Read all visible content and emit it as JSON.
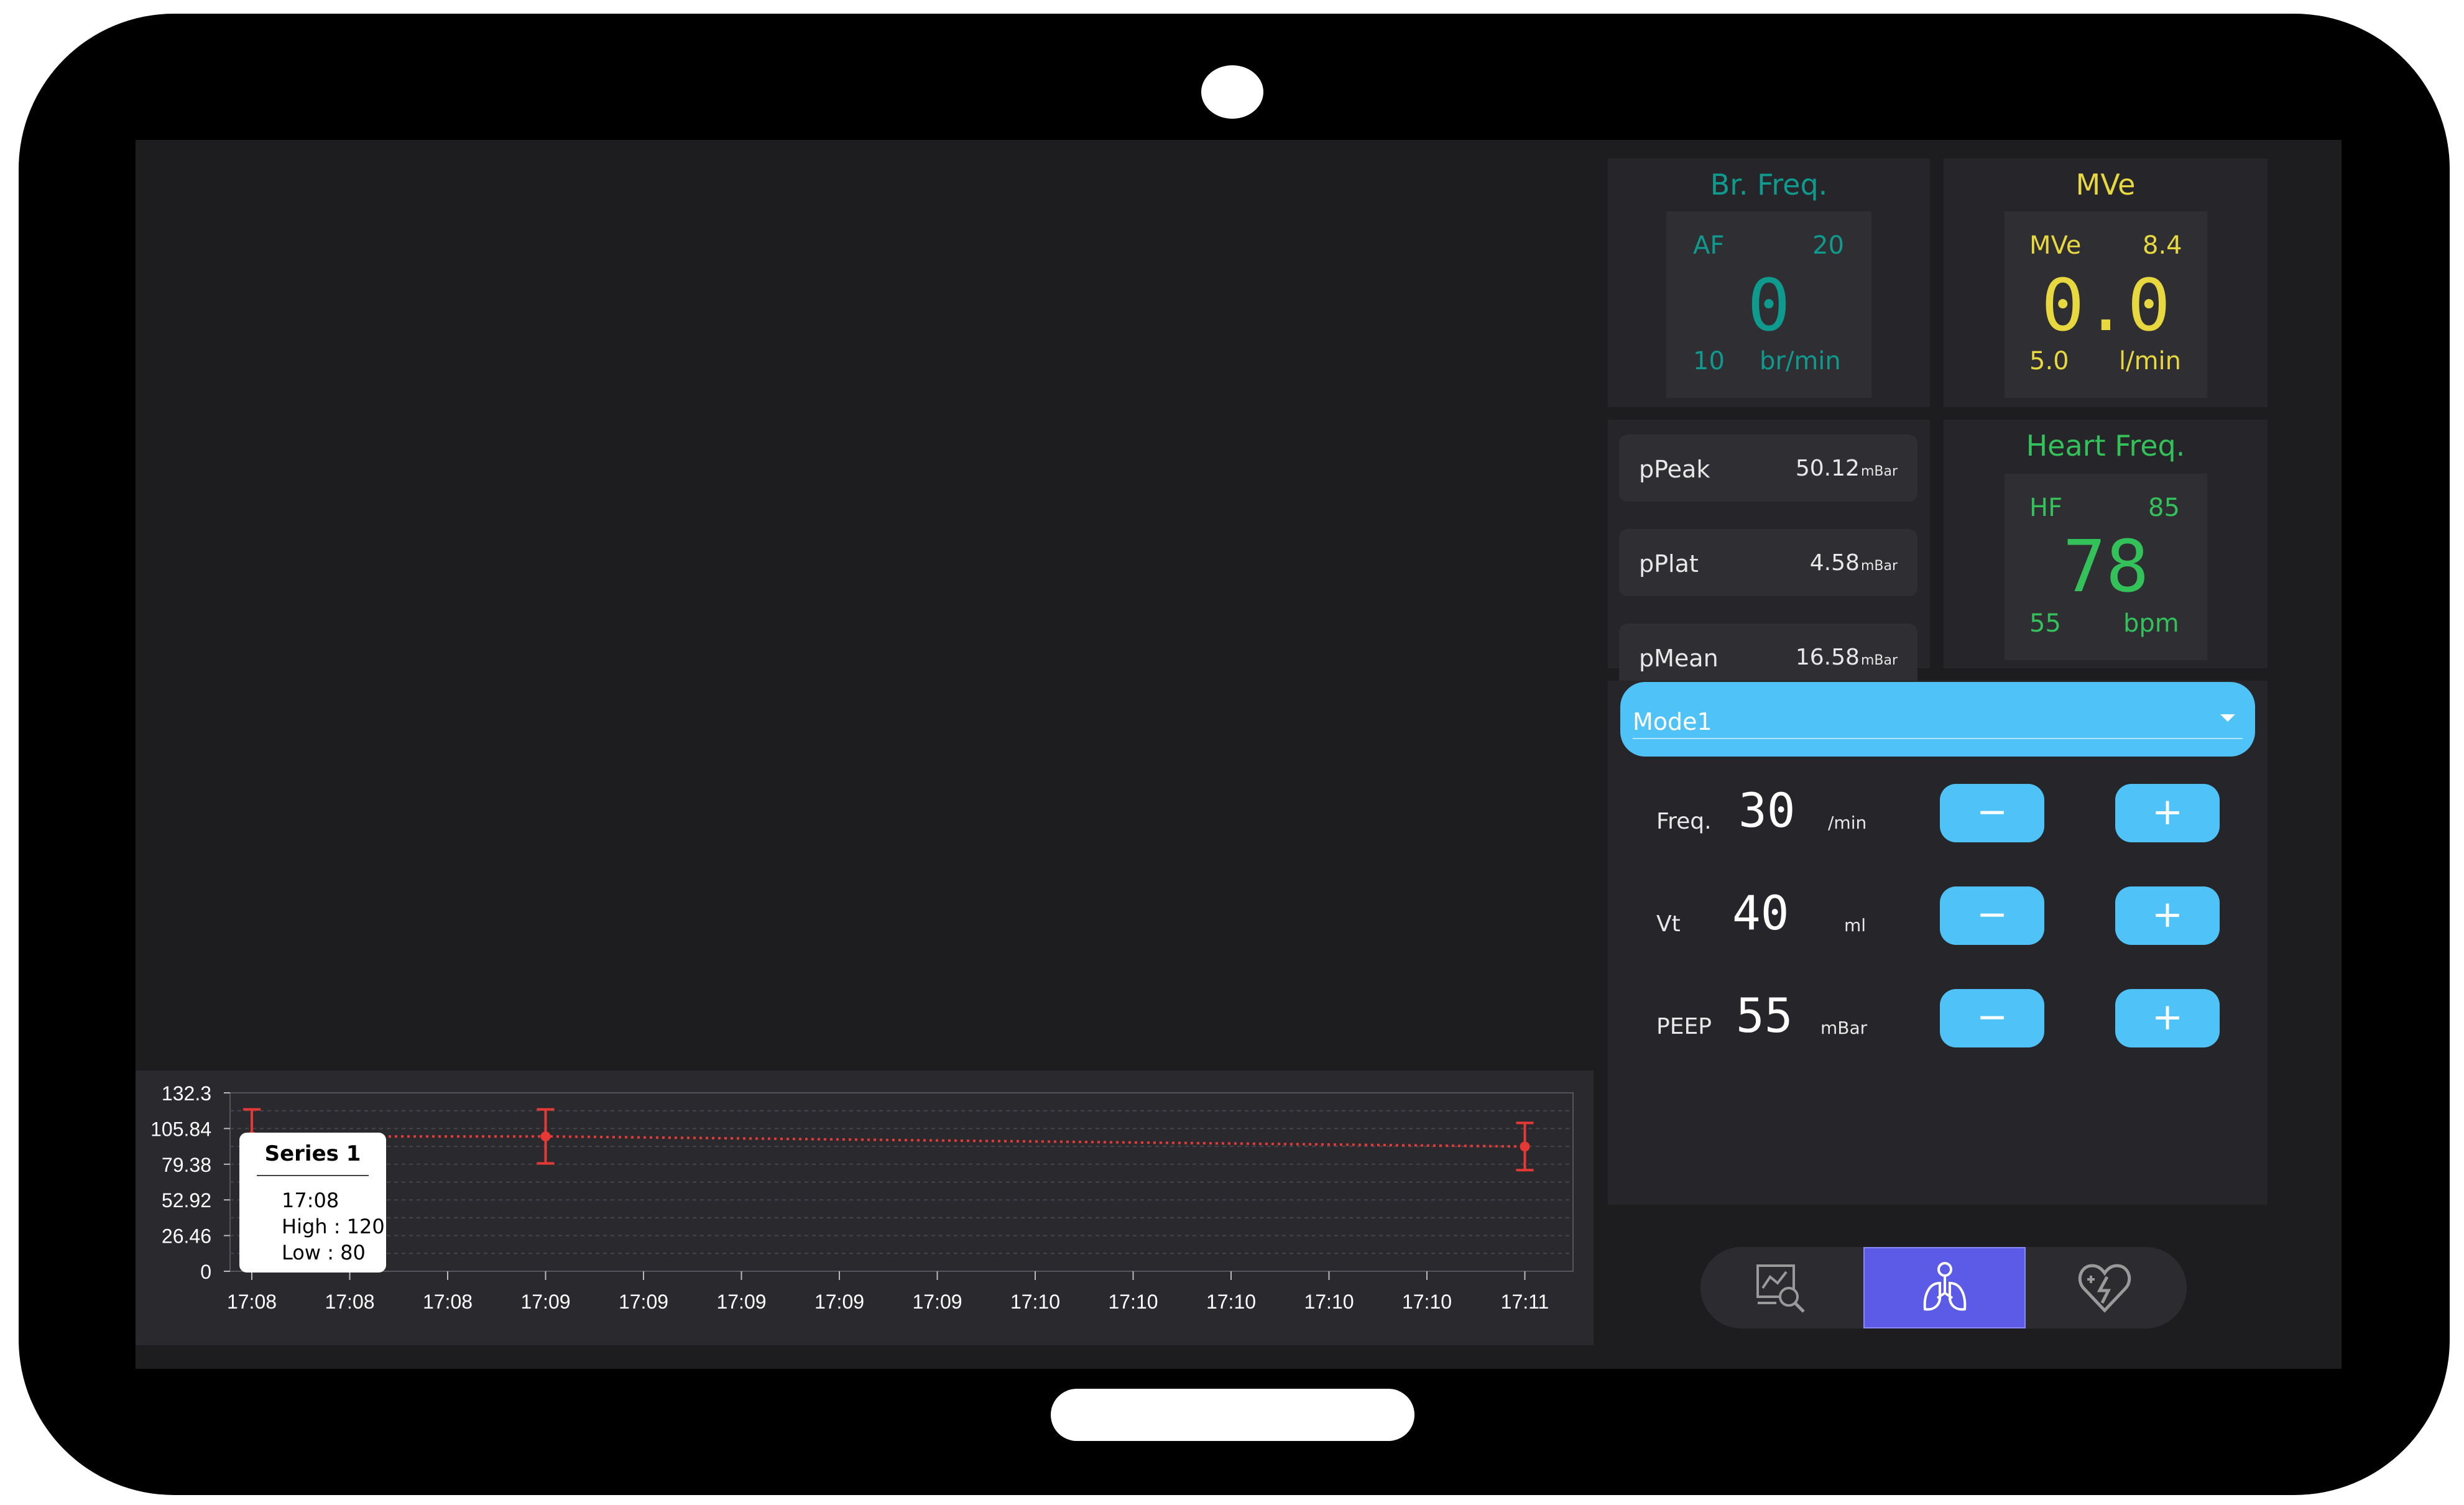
{
  "br_freq": {
    "title": "Br. Freq.",
    "tag": "AF",
    "high": "20",
    "value": "0",
    "low": "10",
    "unit": "br/min",
    "color": "#0f9a8e"
  },
  "mve": {
    "title": "MVe",
    "tag": "MVe",
    "high": "8.4",
    "value": "0.0",
    "low": "5.0",
    "unit": "l/min",
    "color": "#e8d840"
  },
  "heart_freq": {
    "title": "Heart Freq.",
    "tag": "HF",
    "high": "85",
    "value": "78",
    "low": "55",
    "unit": "bpm",
    "color": "#33c25a"
  },
  "pressures": [
    {
      "name": "pPeak",
      "value": "50.12",
      "unit": "mBar"
    },
    {
      "name": "pPlat",
      "value": "4.58",
      "unit": "mBar"
    },
    {
      "name": "pMean",
      "value": "16.58",
      "unit": "mBar"
    }
  ],
  "mode": {
    "selected": "Mode1"
  },
  "controls": [
    {
      "label": "Freq.",
      "value": "30",
      "unit": "/min",
      "minus": "−",
      "plus": "+"
    },
    {
      "label": "Vt",
      "value": "40",
      "unit": "ml",
      "minus": "−",
      "plus": "+"
    },
    {
      "label": "PEEP",
      "value": "55",
      "unit": "mBar",
      "minus": "−",
      "plus": "+"
    }
  ],
  "chart_data": {
    "type": "line",
    "x": [
      "17:08",
      "17:08",
      "17:08",
      "17:09",
      "17:09",
      "17:09",
      "17:09",
      "17:09",
      "17:10",
      "17:10",
      "17:10",
      "17:10",
      "17:10",
      "17:11"
    ],
    "ytick_labels": [
      "132.3",
      "105.84",
      "79.38",
      "52.92",
      "26.46",
      "0"
    ],
    "ylim": [
      0,
      132.3
    ],
    "grid": true,
    "series": [
      {
        "name": "Series 1",
        "color": "#e53935",
        "points": [
          {
            "x": "17:08",
            "high": 120,
            "low": 80
          },
          {
            "x": "17:09",
            "high": 120,
            "low": 80
          },
          {
            "x": "17:11",
            "high": 110,
            "low": 75
          }
        ]
      }
    ],
    "tooltip": {
      "title": "Series 1",
      "time": "17:08",
      "high": "High : 120",
      "low": "Low : 80"
    }
  },
  "nav": {
    "items": [
      "chart-analysis-icon",
      "lungs-icon",
      "heart-pulse-icon"
    ],
    "selected": 1
  }
}
